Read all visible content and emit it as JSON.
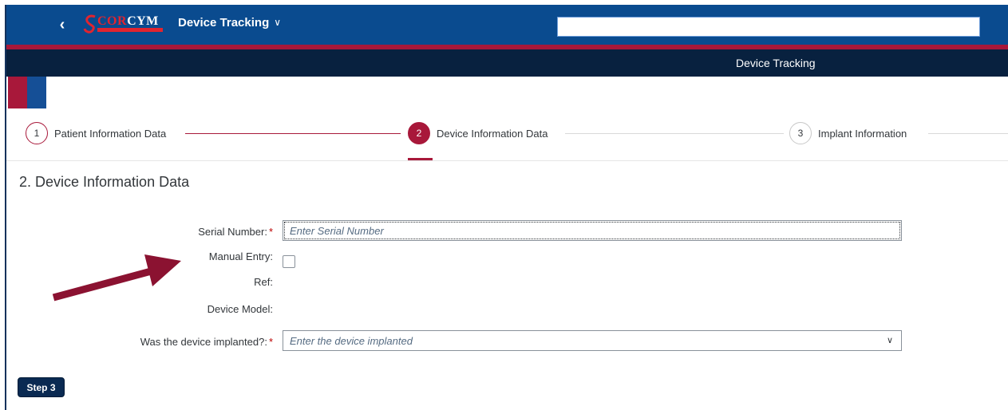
{
  "shell": {
    "back_icon": "chevron-left-icon",
    "logo_text_main": "COR",
    "logo_text_end": "CYM",
    "app_title": "Device Tracking",
    "app_title_icon": "chevron-down-icon",
    "search_value": ""
  },
  "subheader": {
    "title": "Device Tracking"
  },
  "wizard": {
    "steps": [
      {
        "number": "1",
        "label": "Patient Information Data"
      },
      {
        "number": "2",
        "label": "Device Information Data"
      },
      {
        "number": "3",
        "label": "Implant Information"
      }
    ],
    "active_step": 2
  },
  "form": {
    "title": "2. Device Information Data",
    "serial_number_label": "Serial Number:",
    "serial_number_placeholder": "Enter Serial Number",
    "manual_entry_label": "Manual Entry:",
    "manual_entry_checked": false,
    "ref_label": "Ref:",
    "ref_value": "",
    "device_model_label": "Device Model:",
    "device_model_value": "",
    "implanted_label": "Was the device implanted?:",
    "implanted_placeholder": "Enter the device implanted",
    "required_marker": "*"
  },
  "footer": {
    "step3_label": "Step 3"
  },
  "colors": {
    "shell_blue": "#0a4b8f",
    "accent_red": "#a8183a",
    "subbar_navy": "#08213f",
    "annotation_arrow": "#8b1231"
  }
}
